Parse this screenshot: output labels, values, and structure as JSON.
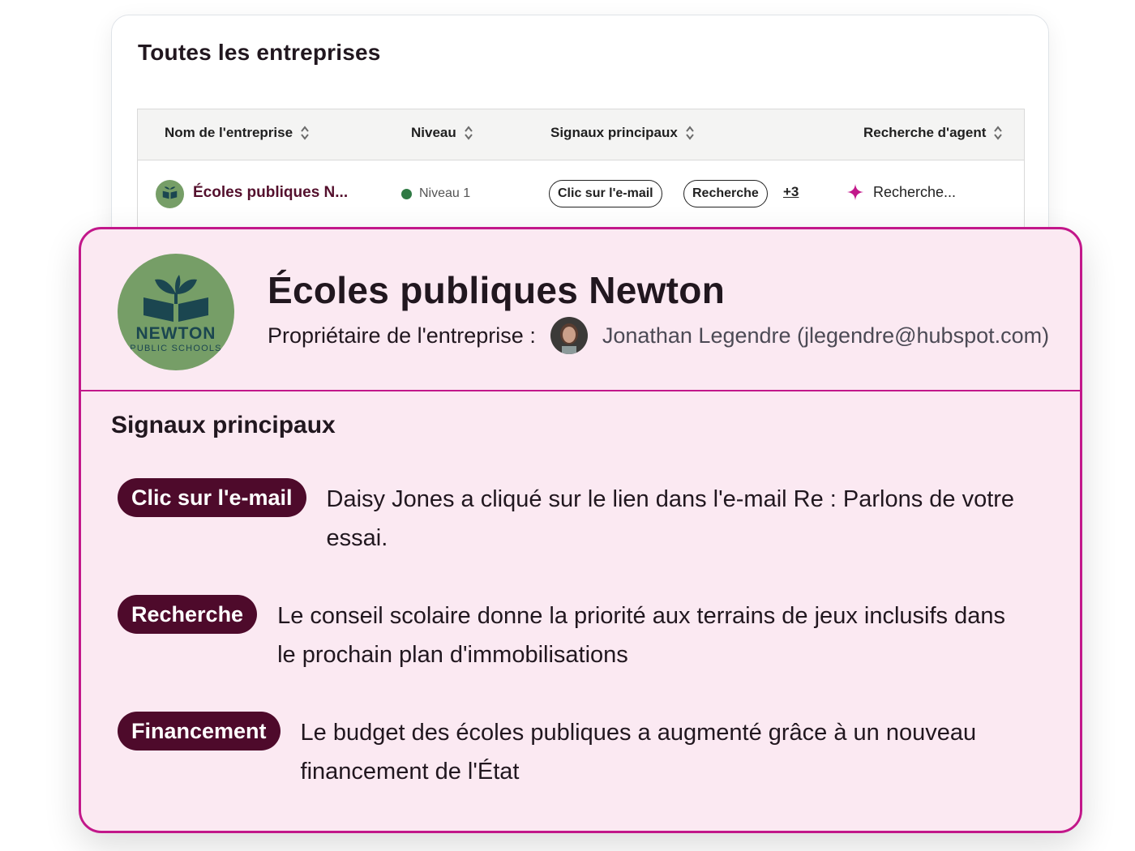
{
  "table_card": {
    "title": "Toutes les entreprises",
    "columns": [
      "Nom de l'entreprise",
      "Niveau",
      "Signaux principaux",
      "Recherche d'agent"
    ],
    "row": {
      "company": "Écoles publiques N...",
      "level": "Niveau 1",
      "signals": [
        "Clic sur l'e-mail",
        "Recherche"
      ],
      "more": "+3",
      "agent_research": "Recherche..."
    }
  },
  "detail_card": {
    "title": "Écoles publiques Newton",
    "logo": {
      "line1": "NEWTON",
      "line2": "PUBLIC SCHOOLS"
    },
    "owner_label": "Propriétaire de l'entreprise :",
    "owner_name": "Jonathan Legendre (jlegendre@hubspot.com)",
    "signals_title": "Signaux principaux",
    "signals": [
      {
        "tag": "Clic sur l'e-mail",
        "text": "Daisy Jones a cliqué sur le lien dans l'e-mail Re : Parlons de votre essai."
      },
      {
        "tag": "Recherche",
        "text": "Le conseil scolaire donne la priorité aux terrains de jeux inclusifs dans le prochain plan d'immobilisations"
      },
      {
        "tag": "Financement",
        "text": "Le budget des écoles publiques a augmenté grâce à un nouveau financement de l'État"
      }
    ]
  },
  "colors": {
    "accent_magenta": "#c2178a",
    "card_pink": "#fbe9f2",
    "pill_dark": "#4e0a2b",
    "logo_green": "#769e67",
    "level_green": "#2f7a44"
  },
  "icons": {
    "sort": "sort-updown-icon",
    "agent": "sparkle-icon",
    "logo": "book-sprout-icon"
  }
}
